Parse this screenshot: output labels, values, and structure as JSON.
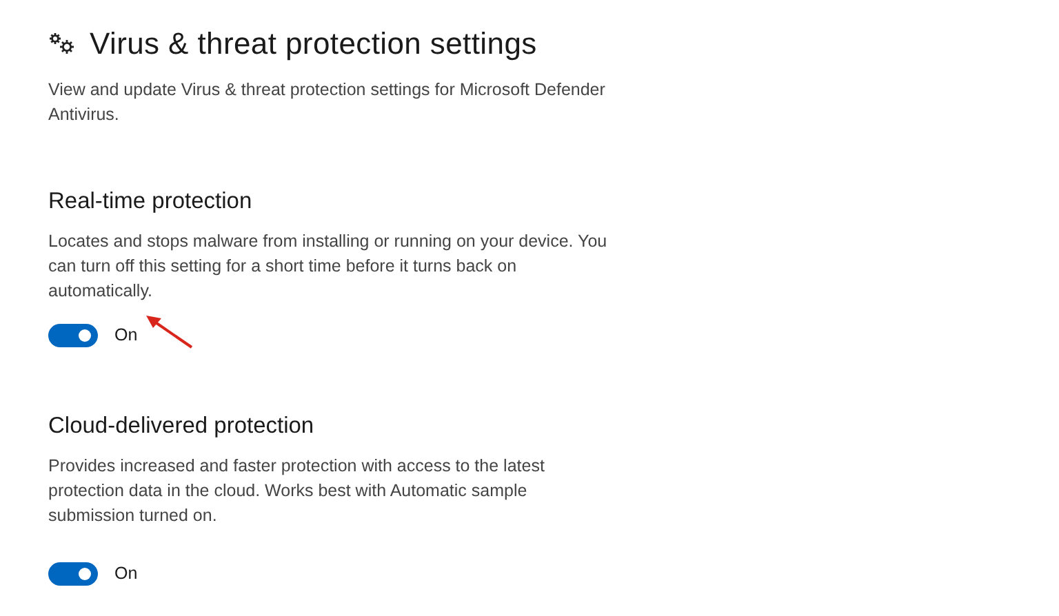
{
  "page": {
    "title": "Virus & threat protection settings",
    "description": "View and update Virus & threat protection settings for Microsoft Defender Antivirus."
  },
  "sections": [
    {
      "heading": "Real-time protection",
      "description": "Locates and stops malware from installing or running on your device. You can turn off this setting for a short time before it turns back on automatically.",
      "toggle": {
        "on": true,
        "label": "On"
      },
      "pointed_at": true
    },
    {
      "heading": "Cloud-delivered protection",
      "description": "Provides increased and faster protection with access to the latest protection data in the cloud. Works best with Automatic sample submission turned on.",
      "toggle": {
        "on": true,
        "label": "On"
      }
    }
  ]
}
